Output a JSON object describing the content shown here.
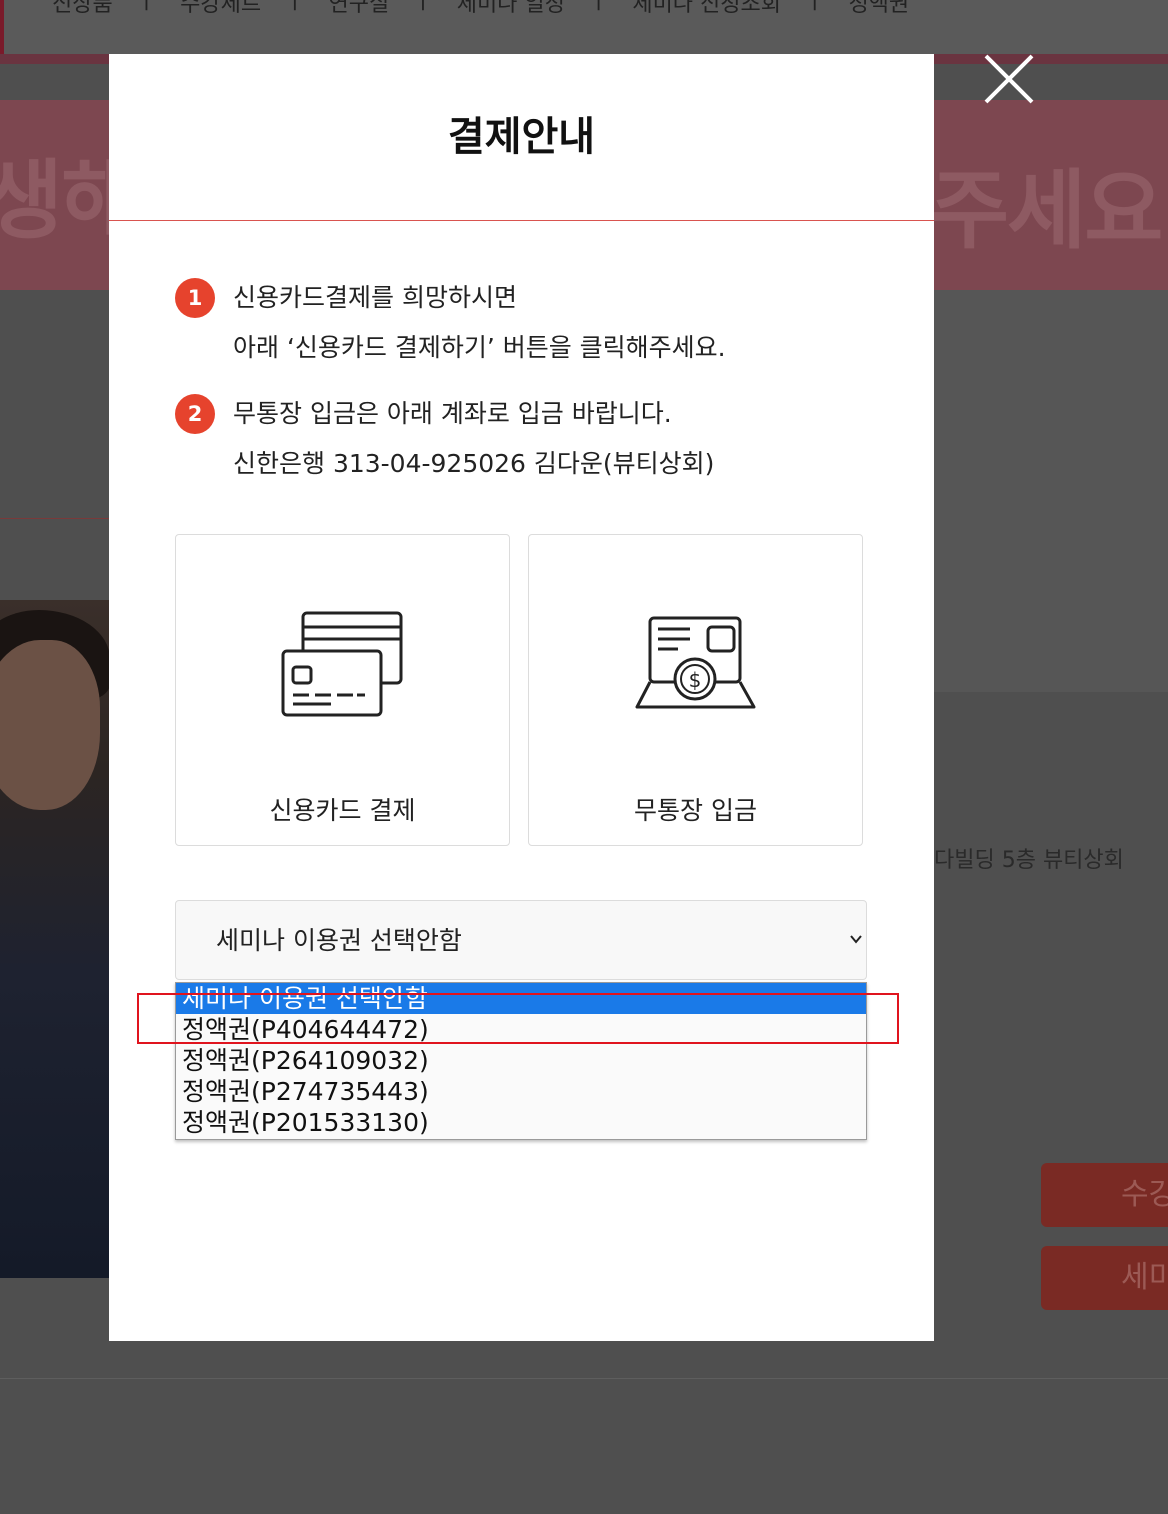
{
  "background_page": {
    "nav_items": [
      "신상품",
      "수강세트",
      "연구실",
      "세미나 일정",
      "세미나 신청조회",
      "정액권"
    ],
    "hero_text_left": "생해",
    "hero_text_right": "주세요",
    "address_text": "다빌딩 5층 뷰티상회",
    "button_1_label": "수강",
    "button_2_label": "세미"
  },
  "modal": {
    "title": "결제안내",
    "close_label": "close",
    "steps": [
      {
        "number": "1",
        "line1": "신용카드결제를 희망하시면",
        "line2": "아래 ‘신용카드 결제하기’ 버튼을 클릭해주세요."
      },
      {
        "number": "2",
        "line1": "무통장 입금은 아래 계좌로 입금 바랍니다.",
        "line2": "신한은행 313-04-925026 김다운(뷰티상회)"
      }
    ],
    "payment_options": {
      "card_label": "신용카드 결제",
      "bank_label": "무통장 입금"
    },
    "voucher_select": {
      "selected_value": "세미나 이용권 선택안함",
      "options": [
        "세미나 이용권 선택안함",
        "정액권(P404644472)",
        "정액권(P264109032)",
        "정액권(P274735443)",
        "정액권(P201533130)"
      ],
      "highlighted_index": 0
    }
  },
  "colors": {
    "accent_red": "#e6432d",
    "highlight_blue": "#1a7ae8",
    "annotation_red": "#e0141e",
    "overlay": "#4f4f4f"
  }
}
